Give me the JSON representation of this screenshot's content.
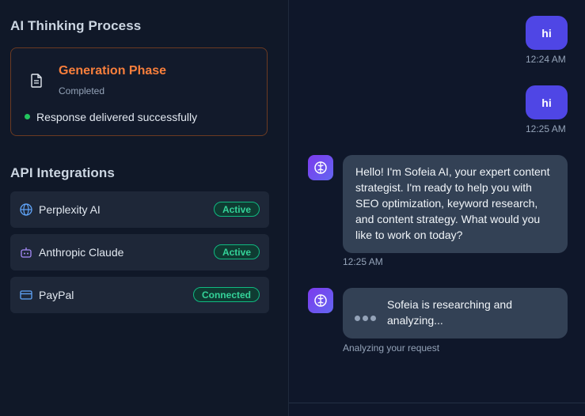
{
  "sidebar": {
    "thinking_title": "AI Thinking Process",
    "phase": {
      "title": "Generation Phase",
      "status": "Completed",
      "message": "Response delivered successfully"
    },
    "integrations_title": "API Integrations",
    "integrations": [
      {
        "name": "Perplexity AI",
        "badge": "Active",
        "icon": "globe-icon"
      },
      {
        "name": "Anthropic Claude",
        "badge": "Active",
        "icon": "bot-icon"
      },
      {
        "name": "PayPal",
        "badge": "Connected",
        "icon": "credit-card-icon"
      }
    ]
  },
  "chat": {
    "messages": [
      {
        "role": "user",
        "text": "hi",
        "time": "12:24 AM"
      },
      {
        "role": "user",
        "text": "hi",
        "time": "12:25 AM"
      },
      {
        "role": "assistant",
        "text": "Hello! I'm Sofeia AI, your expert content strategist. I'm ready to help you with SEO optimization, keyword research, and content strategy. What would you like to work on today?",
        "time": "12:25 AM"
      }
    ],
    "typing": {
      "text": "Sofeia is researching and analyzing...",
      "status": "Analyzing your request"
    }
  },
  "colors": {
    "accent": "#4f46e5",
    "phase_orange": "#f97f3c",
    "success": "#22c55e",
    "badge_green": "#34d399"
  }
}
